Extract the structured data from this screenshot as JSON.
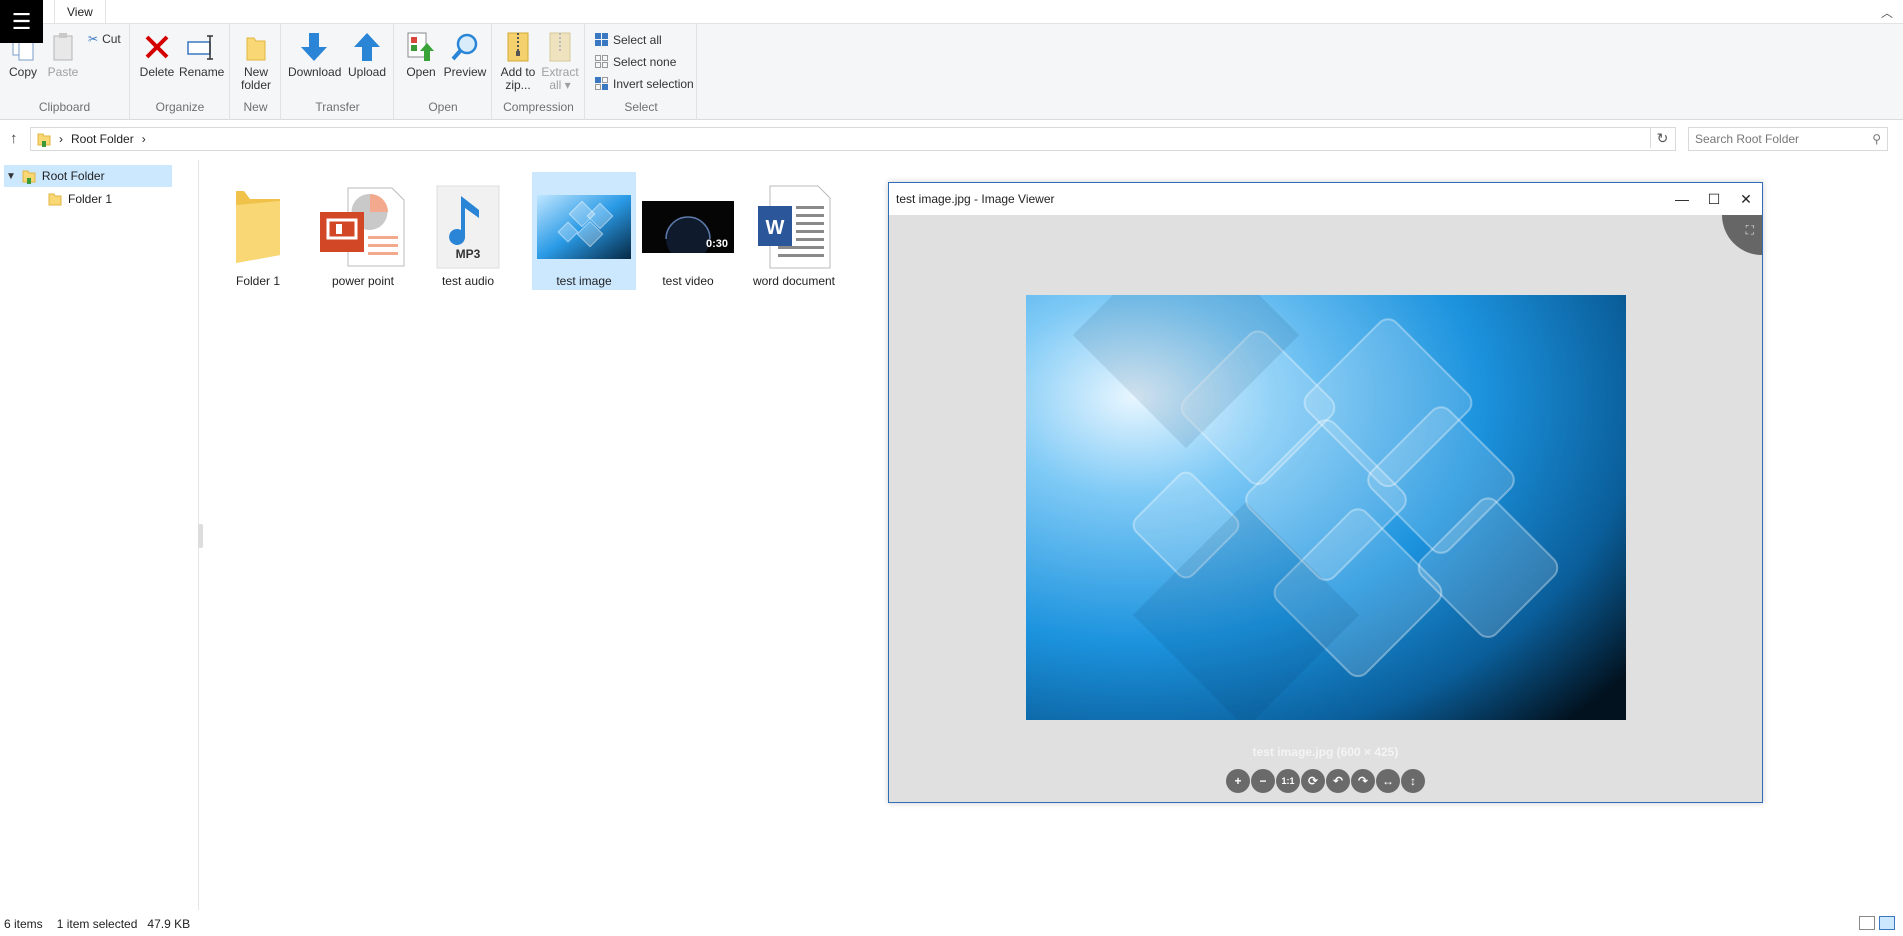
{
  "menu_icon": "hamburger-icon",
  "tabs": {
    "view": "View"
  },
  "ribbon": {
    "clipboard": {
      "label": "Clipboard",
      "copy": "Copy",
      "paste": "Paste",
      "cut": "Cut"
    },
    "organize": {
      "label": "Organize",
      "delete": "Delete",
      "rename": "Rename"
    },
    "new": {
      "label": "New",
      "new_folder_l1": "New",
      "new_folder_l2": "folder"
    },
    "transfer": {
      "label": "Transfer",
      "download": "Download",
      "upload": "Upload"
    },
    "open": {
      "label": "Open",
      "open": "Open",
      "preview": "Preview"
    },
    "compression": {
      "label": "Compression",
      "add_l1": "Add to",
      "add_l2": "zip...",
      "extract_l1": "Extract",
      "extract_l2": "all ▾"
    },
    "select": {
      "label": "Select",
      "all": "Select all",
      "none": "Select none",
      "invert": "Invert selection"
    }
  },
  "address": {
    "path": "Root Folder",
    "search_placeholder": "Search Root Folder"
  },
  "tree": [
    {
      "label": "Root Folder"
    },
    {
      "label": "Folder 1"
    }
  ],
  "files": [
    {
      "name": "Folder 1"
    },
    {
      "name": "power point"
    },
    {
      "name": "test audio",
      "badge": "MP3"
    },
    {
      "name": "test image"
    },
    {
      "name": "test video",
      "duration": "0:30"
    },
    {
      "name": "word document",
      "badge": "W"
    }
  ],
  "viewer": {
    "title": "test image.jpg - Image Viewer",
    "caption": "test image.jpg (600 × 425)",
    "toolbar": [
      "+",
      "−",
      "1:1",
      "⟳",
      "↶",
      "↷",
      "↔",
      "↕"
    ]
  },
  "status": {
    "count": "6 items",
    "selected": "1 item selected",
    "size": "47.9 KB"
  },
  "colors": {
    "accent": "#2e6fb7",
    "selection": "#cce8ff",
    "folder": "#f8d774"
  }
}
